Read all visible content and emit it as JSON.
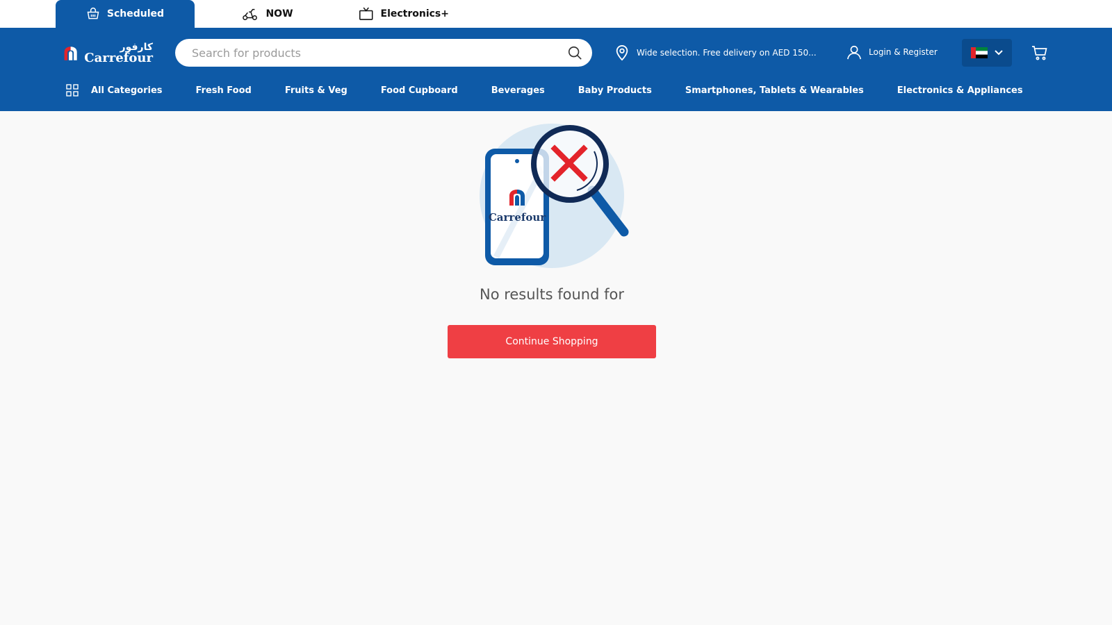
{
  "mode_tabs": [
    {
      "label": "Scheduled",
      "icon": "shopping-basket-icon"
    },
    {
      "label": "NOW",
      "icon": "scooter-icon"
    },
    {
      "label": "Electronics+",
      "icon": "tv-icon"
    }
  ],
  "logo": {
    "arabic": "كارفور",
    "english": "Carrefour"
  },
  "search": {
    "placeholder": "Search for products",
    "value": ""
  },
  "delivery": {
    "text": "Wide selection. Free delivery on AED 150..."
  },
  "login": {
    "label": "Login & Register"
  },
  "language": {
    "flag": "uae-flag-icon"
  },
  "categories": [
    "All Categories",
    "Fresh Food",
    "Fruits & Veg",
    "Food Cupboard",
    "Beverages",
    "Baby Products",
    "Smartphones, Tablets & Wearables",
    "Electronics & Appliances"
  ],
  "empty_state": {
    "illustration_brand": "Carrefour",
    "message": "No results found for",
    "button_label": "Continue Shopping"
  },
  "colors": {
    "header_blue": "#0e5aa7",
    "accent_red": "#ef3f44",
    "background": "#f9f9f9"
  }
}
